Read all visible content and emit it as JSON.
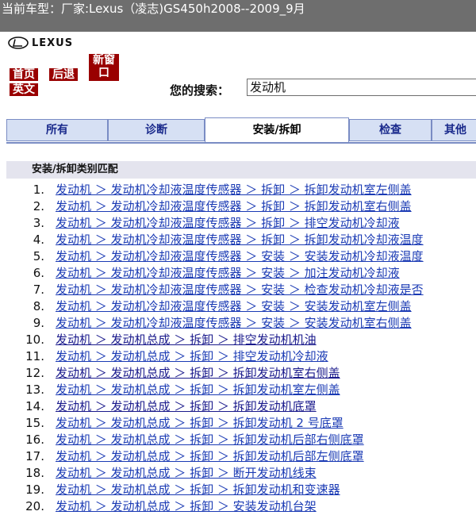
{
  "window": {
    "title": "当前车型：厂家:Lexus（凌志)GS450h2008--2009_9月"
  },
  "logo": {
    "text": "LEXUS"
  },
  "nav": {
    "home": "首页",
    "back": "后退",
    "new_window": "新窗口",
    "english": "英文"
  },
  "search": {
    "label": "您的搜索：",
    "value": "发动机"
  },
  "tabs": [
    "所有",
    "诊断",
    "安装/拆卸",
    "检查",
    "其他"
  ],
  "active_tab": "安装/拆卸",
  "section": {
    "title": "安装/拆卸类别匹配"
  },
  "results": [
    {
      "num": "1.",
      "text": "发动机 ＞ 发动机冷却液温度传感器 ＞ 拆卸 ＞ 拆卸发动机室左侧盖"
    },
    {
      "num": "2.",
      "text": "发动机 ＞ 发动机冷却液温度传感器 ＞ 拆卸 ＞ 拆卸发动机室右侧盖"
    },
    {
      "num": "3.",
      "text": "发动机 ＞ 发动机冷却液温度传感器 ＞ 拆卸 ＞ 排空发动机冷却液"
    },
    {
      "num": "4.",
      "text": "发动机 ＞ 发动机冷却液温度传感器 ＞ 拆卸 ＞ 拆卸发动机冷却液温度"
    },
    {
      "num": "5.",
      "text": "发动机 ＞ 发动机冷却液温度传感器 ＞ 安装 ＞ 安装发动机冷却液温度"
    },
    {
      "num": "6.",
      "text": "发动机 ＞ 发动机冷却液温度传感器 ＞ 安装 ＞ 加注发动机冷却液"
    },
    {
      "num": "7.",
      "text": "发动机 ＞ 发动机冷却液温度传感器 ＞ 安装 ＞ 检查发动机冷却液是否"
    },
    {
      "num": "8.",
      "text": "发动机 ＞ 发动机冷却液温度传感器 ＞ 安装 ＞ 安装发动机室左侧盖"
    },
    {
      "num": "9.",
      "text": "发动机 ＞ 发动机冷却液温度传感器 ＞ 安装 ＞ 安装发动机室右侧盖"
    },
    {
      "num": "10.",
      "text": "发动机 ＞ 发动机总成 ＞ 拆卸 ＞ 排空发动机机油"
    },
    {
      "num": "11.",
      "text": "发动机 ＞ 发动机总成 ＞ 拆卸 ＞ 排空发动机冷却液"
    },
    {
      "num": "12.",
      "text": "发动机 ＞ 发动机总成 ＞ 拆卸 ＞ 拆卸发动机室右侧盖"
    },
    {
      "num": "13.",
      "text": "发动机 ＞ 发动机总成 ＞ 拆卸 ＞ 拆卸发动机室左侧盖"
    },
    {
      "num": "14.",
      "text": "发动机 ＞ 发动机总成 ＞ 拆卸 ＞ 拆卸发动机底罩"
    },
    {
      "num": "15.",
      "text": "发动机 ＞ 发动机总成 ＞ 拆卸 ＞ 拆卸发动机 2 号底罩"
    },
    {
      "num": "16.",
      "text": "发动机 ＞ 发动机总成 ＞ 拆卸 ＞ 拆卸发动机后部右侧底罩"
    },
    {
      "num": "17.",
      "text": "发动机 ＞ 发动机总成 ＞ 拆卸 ＞ 拆卸发动机后部左侧底罩"
    },
    {
      "num": "18.",
      "text": "发动机 ＞ 发动机总成 ＞ 拆卸 ＞ 断开发动机线束"
    },
    {
      "num": "19.",
      "text": "发动机 ＞ 发动机总成 ＞ 拆卸 ＞ 拆卸发动机和变速器"
    },
    {
      "num": "20.",
      "text": "发动机 ＞ 发动机总成 ＞ 拆卸 ＞ 安装发动机台架"
    }
  ],
  "colors": {
    "titlebar": "#6e6e6e",
    "nav_button": "#990000",
    "tab_bg": "#d6e0f4",
    "link": "#1a3ab4"
  }
}
